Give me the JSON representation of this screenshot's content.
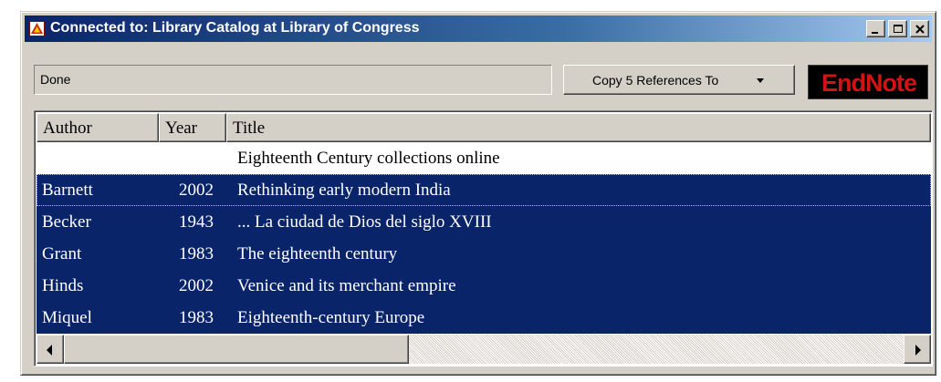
{
  "window": {
    "title": "Connected to: Library Catalog at Library of Congress",
    "controls": [
      "minimize",
      "maximize",
      "close"
    ]
  },
  "status": {
    "text": "Done"
  },
  "toolbar": {
    "copy_label": "Copy 5 References To",
    "copy_icon": "chevron-down-icon"
  },
  "logo": {
    "text": "EndNote",
    "color": "#d01414",
    "background": "#000000"
  },
  "table": {
    "columns": [
      "Author",
      "Year",
      "Title"
    ],
    "rows": [
      {
        "author": "",
        "year": "",
        "title": "Eighteenth Century collections online",
        "selected": false
      },
      {
        "author": "Barnett",
        "year": "2002",
        "title": "Rethinking early modern India",
        "selected": true
      },
      {
        "author": "Becker",
        "year": "1943",
        "title": "... La ciudad de Dios del siglo XVIII",
        "selected": true
      },
      {
        "author": "Grant",
        "year": "1983",
        "title": "The eighteenth century",
        "selected": true
      },
      {
        "author": "Hinds",
        "year": "2002",
        "title": "Venice and its merchant empire",
        "selected": true
      },
      {
        "author": "Miquel",
        "year": "1983",
        "title": "Eighteenth-century Europe",
        "selected": true
      }
    ]
  },
  "colors": {
    "selection": "#0a246a",
    "face": "#d4d0c8",
    "title_gradient_start": "#0a246a",
    "title_gradient_end": "#a6caf0"
  }
}
